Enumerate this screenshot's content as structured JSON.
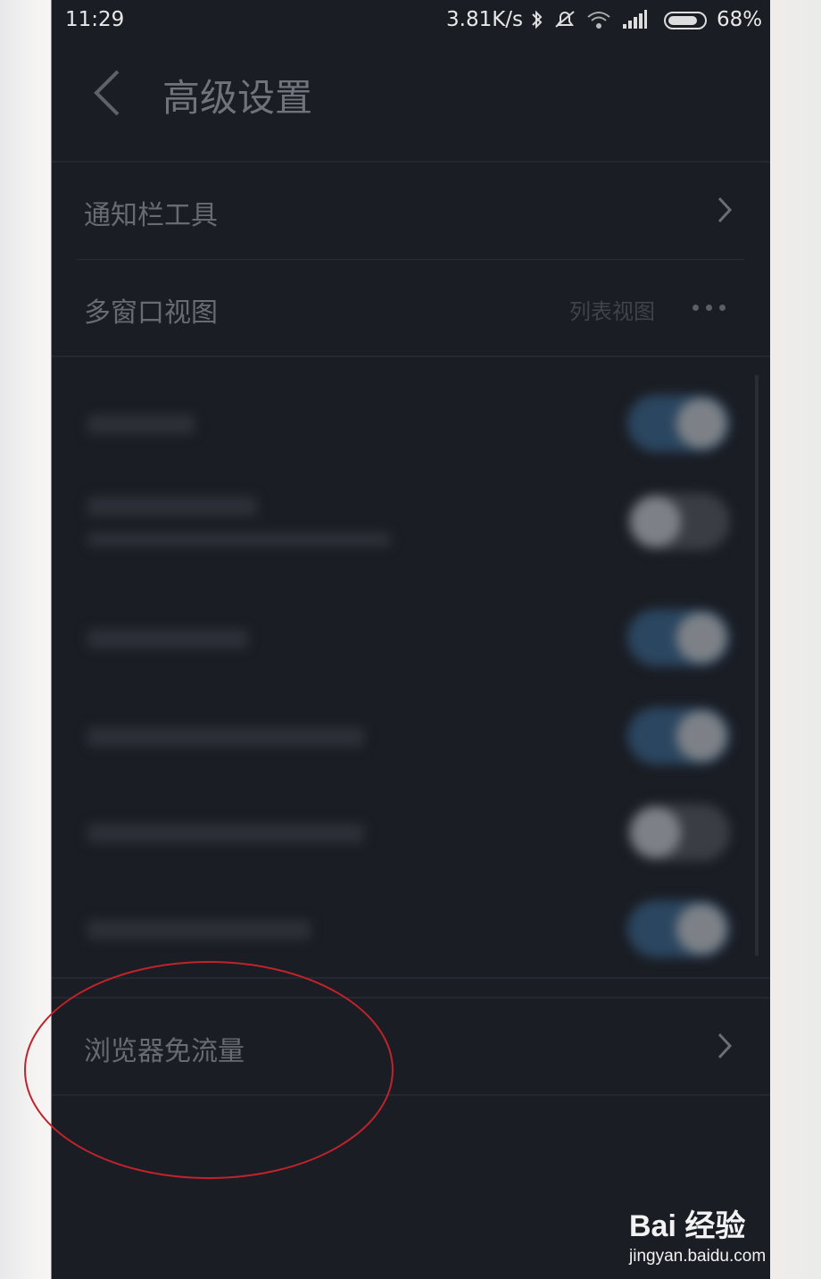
{
  "status_bar": {
    "time": "11:29",
    "network_speed": "3.81K/s",
    "battery": "68%",
    "icons": [
      "bluetooth-icon",
      "mute-icon",
      "wifi-icon",
      "signal-icon",
      "battery-icon"
    ]
  },
  "header": {
    "back_icon": "chevron-left-icon",
    "title": "高级设置"
  },
  "settings": [
    {
      "label": "通知栏工具",
      "accessory": "chevron-right-icon"
    },
    {
      "label": "多窗口视图",
      "value": "列表视图",
      "accessory": "more-dots-icon"
    }
  ],
  "blurred_toggles": [
    {
      "state": "on"
    },
    {
      "state": "off"
    },
    {
      "state": "on"
    },
    {
      "state": "on"
    },
    {
      "state": "off"
    },
    {
      "state": "on"
    }
  ],
  "browser_data_free": {
    "label": "浏览器免流量",
    "accessory": "chevron-right-icon"
  },
  "annotation": {
    "shape": "ellipse",
    "color": "#c0232b"
  },
  "watermark": {
    "brand": "Bai  经验",
    "url": "jingyan.baidu.com"
  },
  "colors": {
    "background": "#1a1d24",
    "toggle_on": "#2b4660",
    "annotation": "#c0232b"
  }
}
